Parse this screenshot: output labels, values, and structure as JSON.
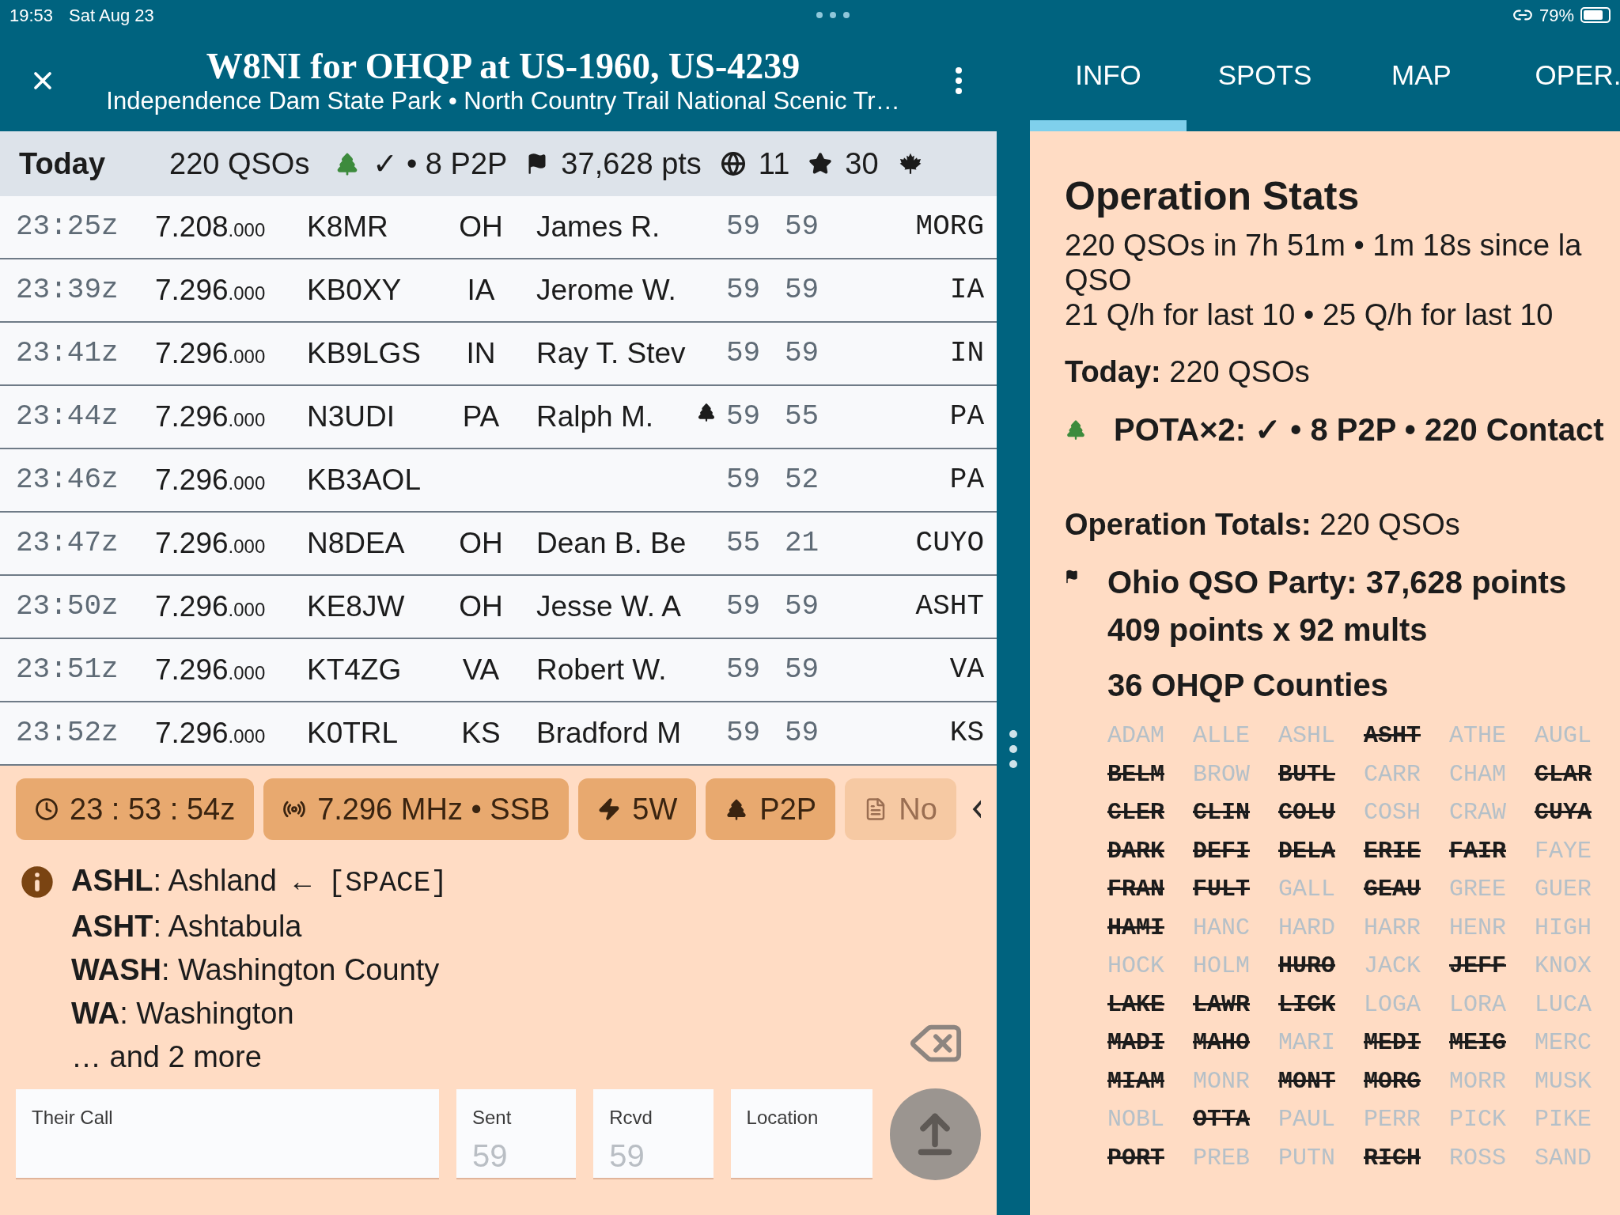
{
  "status_bar": {
    "time": "19:53",
    "date": "Sat Aug 23",
    "battery": "79%"
  },
  "header": {
    "title": "W8NI for OHQP at US-1960, US-4239",
    "subtitle": "Independence Dam State Park • North Country Trail National Scenic Tr…"
  },
  "tabs": [
    {
      "label": "INFO",
      "selected": true
    },
    {
      "label": "SPOTS",
      "selected": false
    },
    {
      "label": "MAP",
      "selected": false
    },
    {
      "label": "OPER.",
      "selected": false
    }
  ],
  "summary": {
    "label": "Today",
    "qsos": "220 QSOs",
    "pota": "✓ • 8 P2P",
    "points": "37,628 pts",
    "countries": "11",
    "states": "30"
  },
  "qsos": [
    {
      "time": "23:25z",
      "freq": "7.208",
      "freq_decimals": ".000",
      "call": "K8MR",
      "state": "OH",
      "name": "James R.",
      "pota": false,
      "sent": "59",
      "rcvd": "59",
      "location": "MORG"
    },
    {
      "time": "23:39z",
      "freq": "7.296",
      "freq_decimals": ".000",
      "call": "KB0XY",
      "state": "IA",
      "name": "Jerome W.",
      "pota": false,
      "sent": "59",
      "rcvd": "59",
      "location": "IA"
    },
    {
      "time": "23:41z",
      "freq": "7.296",
      "freq_decimals": ".000",
      "call": "KB9LGS",
      "state": "IN",
      "name": "Ray T. Stev",
      "pota": false,
      "sent": "59",
      "rcvd": "59",
      "location": "IN"
    },
    {
      "time": "23:44z",
      "freq": "7.296",
      "freq_decimals": ".000",
      "call": "N3UDI",
      "state": "PA",
      "name": "Ralph M.",
      "pota": true,
      "sent": "59",
      "rcvd": "55",
      "location": "PA"
    },
    {
      "time": "23:46z",
      "freq": "7.296",
      "freq_decimals": ".000",
      "call": "KB3AOL",
      "pota": false,
      "sent": "59",
      "rcvd": "52",
      "location": "PA"
    },
    {
      "time": "23:47z",
      "freq": "7.296",
      "freq_decimals": ".000",
      "call": "N8DEA",
      "state": "OH",
      "name": "Dean B. Be",
      "pota": false,
      "sent": "55",
      "rcvd": "21",
      "location": "CUYO"
    },
    {
      "time": "23:50z",
      "freq": "7.296",
      "freq_decimals": ".000",
      "call": "KE8JW",
      "state": "OH",
      "name": "Jesse W. A",
      "pota": false,
      "sent": "59",
      "rcvd": "59",
      "location": "ASHT"
    },
    {
      "time": "23:51z",
      "freq": "7.296",
      "freq_decimals": ".000",
      "call": "KT4ZG",
      "state": "VA",
      "name": "Robert W.",
      "pota": false,
      "sent": "59",
      "rcvd": "59",
      "location": "VA"
    },
    {
      "time": "23:52z",
      "freq": "7.296",
      "freq_decimals": ".000",
      "call": "K0TRL",
      "state": "KS",
      "name": "Bradford M",
      "pota": false,
      "sent": "59",
      "rcvd": "59",
      "location": "KS"
    }
  ],
  "chips": [
    {
      "kind": "time",
      "label": "23 : 53 : 54z",
      "disabled": false
    },
    {
      "kind": "radio",
      "label": "7.296 MHz • SSB",
      "disabled": false
    },
    {
      "kind": "power",
      "label": "5W",
      "disabled": false
    },
    {
      "kind": "pota",
      "label": "P2P",
      "disabled": false
    },
    {
      "kind": "notes",
      "label": "No",
      "disabled": true
    }
  ],
  "suggestions": [
    {
      "text": "**ASHL**: Ashland",
      "hint": "← [SPACE]"
    },
    {
      "text": "**ASHT**: Ashtabula"
    },
    {
      "text": "**WASH**: Washington County"
    },
    {
      "text": "**WA**: Washington"
    }
  ],
  "more": "… and 2 more",
  "fields": [
    {
      "label": "Their Call"
    },
    {
      "label": "Sent",
      "placeholder": "59"
    },
    {
      "label": "Rcvd",
      "placeholder": "59"
    },
    {
      "label": "Location"
    }
  ],
  "stats": {
    "title": "Operation Stats",
    "lines": [
      "220 QSOs in 7h 51m • 1m 18s since la",
      "QSO",
      "21 Q/h for last 10 • 25 Q/h for last 10"
    ],
    "today_label": "Today:",
    "today_value": "220 QSOs",
    "pota": "POTA×2: ✓ • 8 P2P • 220 Contact",
    "totals_label": "Operation Totals:",
    "totals_value": "220 QSOs",
    "contest": "Ohio QSO Party: 37,628 points",
    "contest_detail": "409 points x 92 mults",
    "counties_title": "36 OHQP Counties",
    "counties": [
      {
        "code": "ADAM",
        "worked": false
      },
      {
        "code": "ALLE",
        "worked": false
      },
      {
        "code": "ASHL",
        "worked": false
      },
      {
        "code": "ASHT",
        "worked": true
      },
      {
        "code": "ATHE",
        "worked": false
      },
      {
        "code": "AUGL",
        "worked": false
      },
      {
        "code": "BELM",
        "worked": true
      },
      {
        "code": "BROW",
        "worked": false
      },
      {
        "code": "BUTL",
        "worked": true
      },
      {
        "code": "CARR",
        "worked": false
      },
      {
        "code": "CHAM",
        "worked": false
      },
      {
        "code": "CLAR",
        "worked": true
      },
      {
        "code": "CLER",
        "worked": true
      },
      {
        "code": "CLIN",
        "worked": true
      },
      {
        "code": "COLU",
        "worked": true
      },
      {
        "code": "COSH",
        "worked": false
      },
      {
        "code": "CRAW",
        "worked": false
      },
      {
        "code": "CUYA",
        "worked": true
      },
      {
        "code": "DARK",
        "worked": true
      },
      {
        "code": "DEFI",
        "worked": true
      },
      {
        "code": "DELA",
        "worked": true
      },
      {
        "code": "ERIE",
        "worked": true
      },
      {
        "code": "FAIR",
        "worked": true
      },
      {
        "code": "FAYE",
        "worked": false
      },
      {
        "code": "FRAN",
        "worked": true
      },
      {
        "code": "FULT",
        "worked": true
      },
      {
        "code": "GALL",
        "worked": false
      },
      {
        "code": "GEAU",
        "worked": true
      },
      {
        "code": "GREE",
        "worked": false
      },
      {
        "code": "GUER",
        "worked": false
      },
      {
        "code": "HAMI",
        "worked": true
      },
      {
        "code": "HANC",
        "worked": false
      },
      {
        "code": "HARD",
        "worked": false
      },
      {
        "code": "HARR",
        "worked": false
      },
      {
        "code": "HENR",
        "worked": false
      },
      {
        "code": "HIGH",
        "worked": false
      },
      {
        "code": "HOCK",
        "worked": false
      },
      {
        "code": "HOLM",
        "worked": false
      },
      {
        "code": "HURO",
        "worked": true
      },
      {
        "code": "JACK",
        "worked": false
      },
      {
        "code": "JEFF",
        "worked": true
      },
      {
        "code": "KNOX",
        "worked": false
      },
      {
        "code": "LAKE",
        "worked": true
      },
      {
        "code": "LAWR",
        "worked": true
      },
      {
        "code": "LICK",
        "worked": true
      },
      {
        "code": "LOGA",
        "worked": false
      },
      {
        "code": "LORA",
        "worked": false
      },
      {
        "code": "LUCA",
        "worked": false
      },
      {
        "code": "MADI",
        "worked": true
      },
      {
        "code": "MAHO",
        "worked": true
      },
      {
        "code": "MARI",
        "worked": false
      },
      {
        "code": "MEDI",
        "worked": true
      },
      {
        "code": "MEIG",
        "worked": true
      },
      {
        "code": "MERC",
        "worked": false
      },
      {
        "code": "MIAM",
        "worked": true
      },
      {
        "code": "MONR",
        "worked": false
      },
      {
        "code": "MONT",
        "worked": true
      },
      {
        "code": "MORG",
        "worked": true
      },
      {
        "code": "MORR",
        "worked": false
      },
      {
        "code": "MUSK",
        "worked": false
      },
      {
        "code": "NOBL",
        "worked": false
      },
      {
        "code": "OTTA",
        "worked": true
      },
      {
        "code": "PAUL",
        "worked": false
      },
      {
        "code": "PERR",
        "worked": false
      },
      {
        "code": "PICK",
        "worked": false
      },
      {
        "code": "PIKE",
        "worked": false
      },
      {
        "code": "PORT",
        "worked": true
      },
      {
        "code": "PREB",
        "worked": false
      },
      {
        "code": "PUTN",
        "worked": false
      },
      {
        "code": "RICH",
        "worked": true
      },
      {
        "code": "ROSS",
        "worked": false
      },
      {
        "code": "SAND",
        "worked": false
      }
    ]
  }
}
